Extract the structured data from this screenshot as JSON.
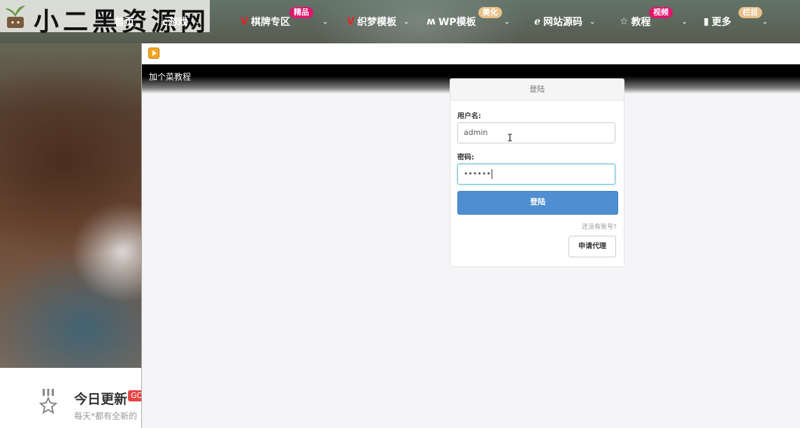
{
  "site": {
    "logo_text": "小二黑资源网",
    "nav": [
      {
        "label": "首页"
      },
      {
        "label": "c游戏"
      },
      {
        "label": "棋牌专区",
        "badge": "精品"
      },
      {
        "label": "织梦模板"
      },
      {
        "label": "WP模板",
        "badge": "美化"
      },
      {
        "label": "网站源码"
      },
      {
        "label": "教程",
        "badge": "视频"
      },
      {
        "label": "更多",
        "badge": "栏目"
      }
    ]
  },
  "section": {
    "title": "今日更新",
    "badge": "GO",
    "desc": "每天*都有全新的"
  },
  "window": {
    "title": "加个菜教程"
  },
  "login": {
    "header": "登陆",
    "username_label": "用户名:",
    "username_value": "admin",
    "password_label": "密码:",
    "password_value": "••••••",
    "submit_label": "登陆",
    "no_account_link": "还没有账号?",
    "apply_agent_label": "申请代理"
  },
  "colors": {
    "primary_button": "#4f8fd1",
    "badge_pink": "#e2156e",
    "badge_tan": "#e8c08a",
    "accent_red": "#e8202a"
  }
}
